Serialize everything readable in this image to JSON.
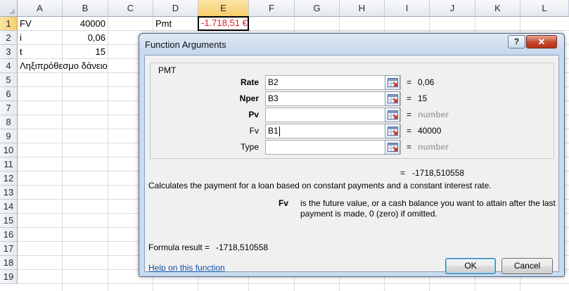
{
  "sheet": {
    "columns": [
      "A",
      "B",
      "C",
      "D",
      "E",
      "F",
      "G",
      "H",
      "I",
      "J",
      "K",
      "L"
    ],
    "rows": [
      "1",
      "2",
      "3",
      "4",
      "5",
      "6",
      "7",
      "8",
      "9",
      "10",
      "11",
      "12",
      "13",
      "14",
      "15",
      "16",
      "17",
      "18",
      "19"
    ],
    "selected_column": "E",
    "selected_row": "1",
    "cells": {
      "A1": "FV",
      "B1": "40000",
      "A2": "i",
      "B2": "0,06",
      "A3": "t",
      "B3": "15",
      "A4": "Ληξιπρόθεσμο δάνειο",
      "D1": "Pmt",
      "E1": "-1.718,51 €"
    }
  },
  "dialog": {
    "title": "Function Arguments",
    "help_button": "?",
    "close_button": "✕",
    "function_name": "PMT",
    "args": [
      {
        "label": "Rate",
        "value": "B2",
        "result": "0,06",
        "required": true
      },
      {
        "label": "Nper",
        "value": "B3",
        "result": "15",
        "required": true
      },
      {
        "label": "Pv",
        "value": "",
        "result": "number",
        "required": true
      },
      {
        "label": "Fv",
        "value": "B1",
        "result": "40000",
        "required": false
      },
      {
        "label": "Type",
        "value": "",
        "result": "number",
        "required": false
      }
    ],
    "equals": "=",
    "overall_result": "-1718,510558",
    "description": "Calculates the payment for a loan based on constant payments and a constant interest rate.",
    "arg_help_name": "Fv",
    "arg_help_text_1": "is the future value, or a cash balance you want to attain after the last",
    "arg_help_text_2": "payment is made, 0 (zero) if omitted.",
    "formula_result_label": "Formula result =",
    "formula_result_value": "-1718,510558",
    "help_link": "Help on this function",
    "ok_label": "OK",
    "cancel_label": "Cancel"
  },
  "colors": {
    "accent_red": "#e11b1b",
    "selected_header": "#f7cd6b",
    "dialog_frame": "#c9dbf0",
    "link": "#0f4fa8"
  }
}
